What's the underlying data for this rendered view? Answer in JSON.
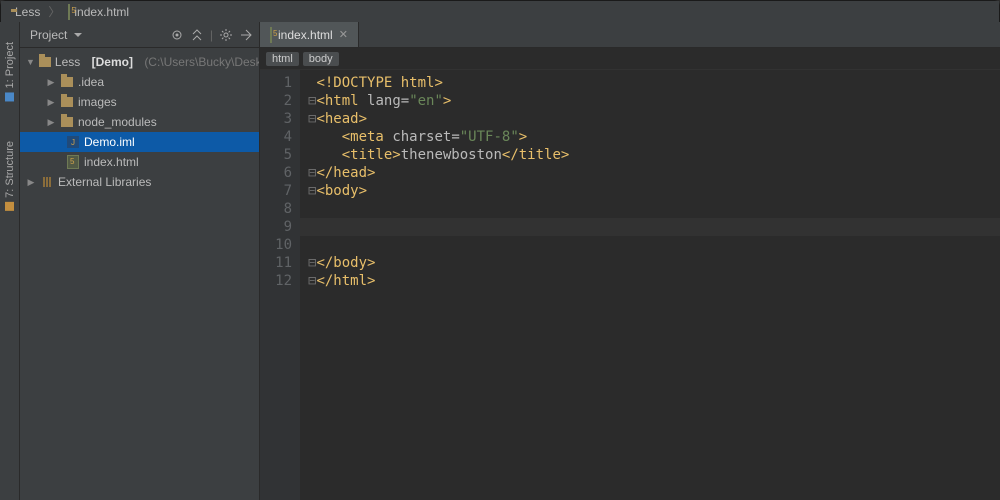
{
  "navbar": {
    "project_name": "Less",
    "file_name": "index.html"
  },
  "stripe": {
    "project_label": "1: Project",
    "structure_label": "7: Structure"
  },
  "project_panel": {
    "title": "Project",
    "root_label": "Less",
    "root_badge": "[Demo]",
    "root_path": "(C:\\Users\\Bucky\\Desktop\\Less)",
    "items": [
      {
        "label": ".idea"
      },
      {
        "label": "images"
      },
      {
        "label": "node_modules"
      },
      {
        "label": "Demo.iml"
      },
      {
        "label": "index.html"
      }
    ],
    "external_libs": "External Libraries"
  },
  "editor": {
    "tab_label": "index.html",
    "crumbs": [
      "html",
      "body"
    ],
    "lines": [
      {
        "n": "1",
        "html": "<span class='fold'> </span><span class='tag'>&lt;!DOCTYPE html&gt;</span>"
      },
      {
        "n": "2",
        "html": "<span class='fold'>⊟</span><span class='tag'>&lt;html</span> <span class='attr'>lang=</span><span class='str'>\"en\"</span><span class='tag'>&gt;</span>"
      },
      {
        "n": "3",
        "html": "<span class='fold'>⊟</span><span class='tag'>&lt;head&gt;</span>"
      },
      {
        "n": "4",
        "html": "    <span class='tag'>&lt;meta</span> <span class='attr'>charset=</span><span class='str'>\"UTF-8\"</span><span class='tag'>&gt;</span>"
      },
      {
        "n": "5",
        "html": "    <span class='tag'>&lt;title&gt;</span><span class='txt'>thenewboston</span><span class='tag'>&lt;/title&gt;</span>"
      },
      {
        "n": "6",
        "html": "<span class='fold'>⊟</span><span class='tag'>&lt;/head&gt;</span>"
      },
      {
        "n": "7",
        "html": "<span class='fold'>⊟</span><span class='tag'>&lt;body&gt;</span>"
      },
      {
        "n": "8",
        "html": ""
      },
      {
        "n": "9",
        "html": ""
      },
      {
        "n": "10",
        "html": ""
      },
      {
        "n": "11",
        "html": "<span class='fold'>⊟</span><span class='tag'>&lt;/body&gt;</span>"
      },
      {
        "n": "12",
        "html": "<span class='fold'>⊟</span><span class='tag'>&lt;/html&gt;</span>"
      }
    ],
    "caret_line_index": 8
  }
}
